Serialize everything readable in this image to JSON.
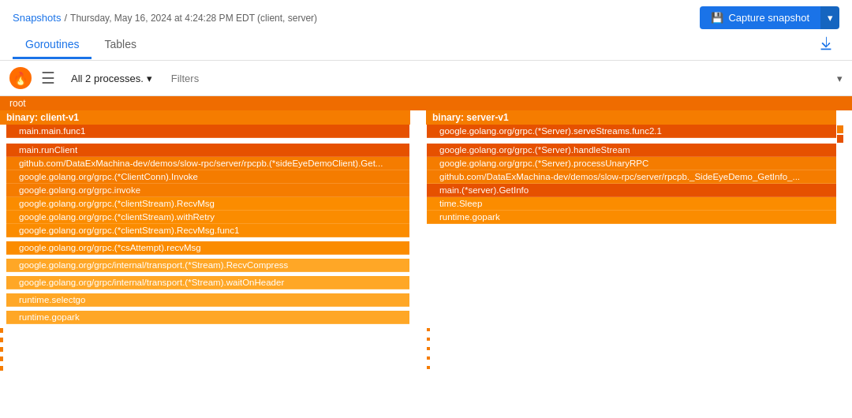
{
  "breadcrumb": {
    "snapshots_label": "Snapshots",
    "separator": "/",
    "date_label": "Thursday, May 16, 2024 at 4:24:28 PM EDT (client, server)"
  },
  "header": {
    "capture_btn_label": "Capture snapshot",
    "capture_icon": "📷"
  },
  "tabs": [
    {
      "id": "goroutines",
      "label": "Goroutines",
      "active": true
    },
    {
      "id": "tables",
      "label": "Tables",
      "active": false
    }
  ],
  "toolbar": {
    "process_label": "All 2 processes.",
    "filters_placeholder": "Filters"
  },
  "tree": {
    "root_label": "root",
    "client_binary": "binary: client-v1",
    "server_binary": "binary: server-v1",
    "client_frames": [
      {
        "label": "main.main.func1",
        "color": "main"
      },
      {
        "label": "main.runClient",
        "color": "main"
      },
      {
        "label": "github.com/DataExMachina-dev/demos/slow-rpc/server/rpcpb.(*sideEyeDemoClient).Get...",
        "color": "orange"
      },
      {
        "label": "google.golang.org/grpc.(*ClientConn).Invoke",
        "color": "orange"
      },
      {
        "label": "google.golang.org/grpc.invoke",
        "color": "orange"
      },
      {
        "label": "google.golang.org/grpc.(*clientStream).RecvMsg",
        "color": "light-orange"
      },
      {
        "label": "google.golang.org/grpc.(*clientStream).withRetry",
        "color": "light-orange"
      },
      {
        "label": "google.golang.org/grpc.(*clientStream).RecvMsg.func1",
        "color": "light-orange"
      },
      {
        "label": "google.golang.org/grpc.(*csAttempt).recvMsg",
        "color": "light-orange"
      },
      {
        "label": "google.golang.org/grpc/internal/transport.(*Stream).RecvCompress",
        "color": "amber"
      },
      {
        "label": "google.golang.org/grpc/internal/transport.(*Stream).waitOnHeader",
        "color": "amber"
      },
      {
        "label": "runtime.selectgo",
        "color": "amber"
      },
      {
        "label": "runtime.gopark",
        "color": "amber"
      }
    ],
    "server_frames": [
      {
        "label": "google.golang.org/grpc.(*Server).serveStreams.func2.1",
        "color": "main"
      },
      {
        "label": "google.golang.org/grpc.(*Server).handleStream",
        "color": "main"
      },
      {
        "label": "google.golang.org/grpc.(*Server).processUnaryRPC",
        "color": "orange"
      },
      {
        "label": "github.com/DataExMachina-dev/demos/slow-rpc/server/rpcpb._SideEyeDemo_GetInfo_...",
        "color": "orange"
      },
      {
        "label": "main.(*server).GetInfo",
        "color": "main"
      },
      {
        "label": "time.Sleep",
        "color": "light-orange"
      },
      {
        "label": "runtime.gopark",
        "color": "light-orange"
      }
    ]
  }
}
